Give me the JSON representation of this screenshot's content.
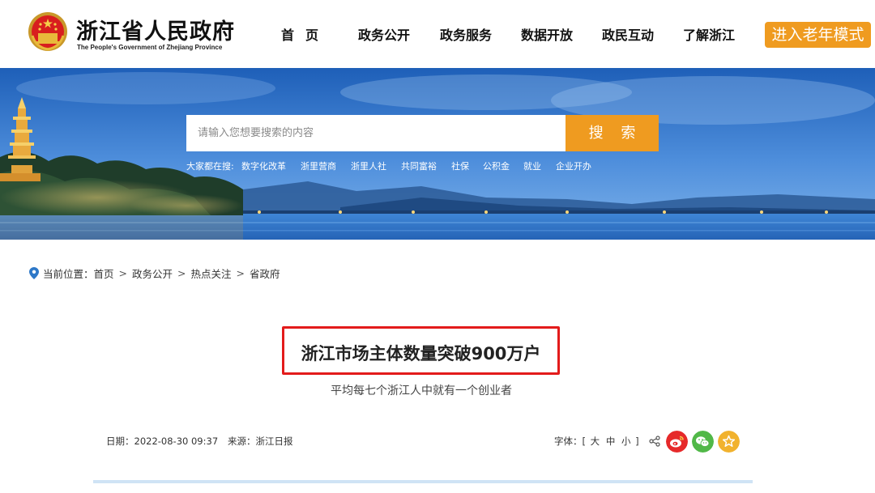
{
  "header": {
    "logo_cn": "浙江省人民政府",
    "logo_en": "The People's Government of Zhejiang Province",
    "nav": [
      "首页",
      "政务公开",
      "政务服务",
      "数据开放",
      "政民互动",
      "了解浙江"
    ],
    "elder_mode": "进入老年模式"
  },
  "search": {
    "placeholder": "请输入您想要搜索的内容",
    "button": "搜 索",
    "hot_label": "大家都在搜:",
    "hot_items": [
      "数字化改革",
      "浙里营商",
      "浙里人社",
      "共同富裕",
      "社保",
      "公积金",
      "就业",
      "企业开办"
    ]
  },
  "breadcrumb": {
    "label": "当前位置：",
    "items": [
      "首页",
      "政务公开",
      "热点关注",
      "省政府"
    ],
    "separator": ">"
  },
  "article": {
    "title": "浙江市场主体数量突破900万户",
    "subtitle": "平均每七个浙江人中就有一个创业者",
    "date_label": "日期：",
    "date": "2022-08-30 09:37",
    "source_label": "来源：",
    "source": "浙江日报",
    "font_label": "字体：[",
    "font_sizes": [
      "大",
      "中",
      "小"
    ],
    "font_close": "]"
  },
  "share": {
    "icons": [
      "share-icon",
      "weibo-icon",
      "wechat-icon",
      "favorite-icon"
    ],
    "colors": {
      "weibo": "#e6292a",
      "wechat": "#51b848",
      "favorite": "#f1b22e"
    }
  },
  "colors": {
    "accent": "#ef9b20",
    "highlight": "#e31b1b"
  }
}
